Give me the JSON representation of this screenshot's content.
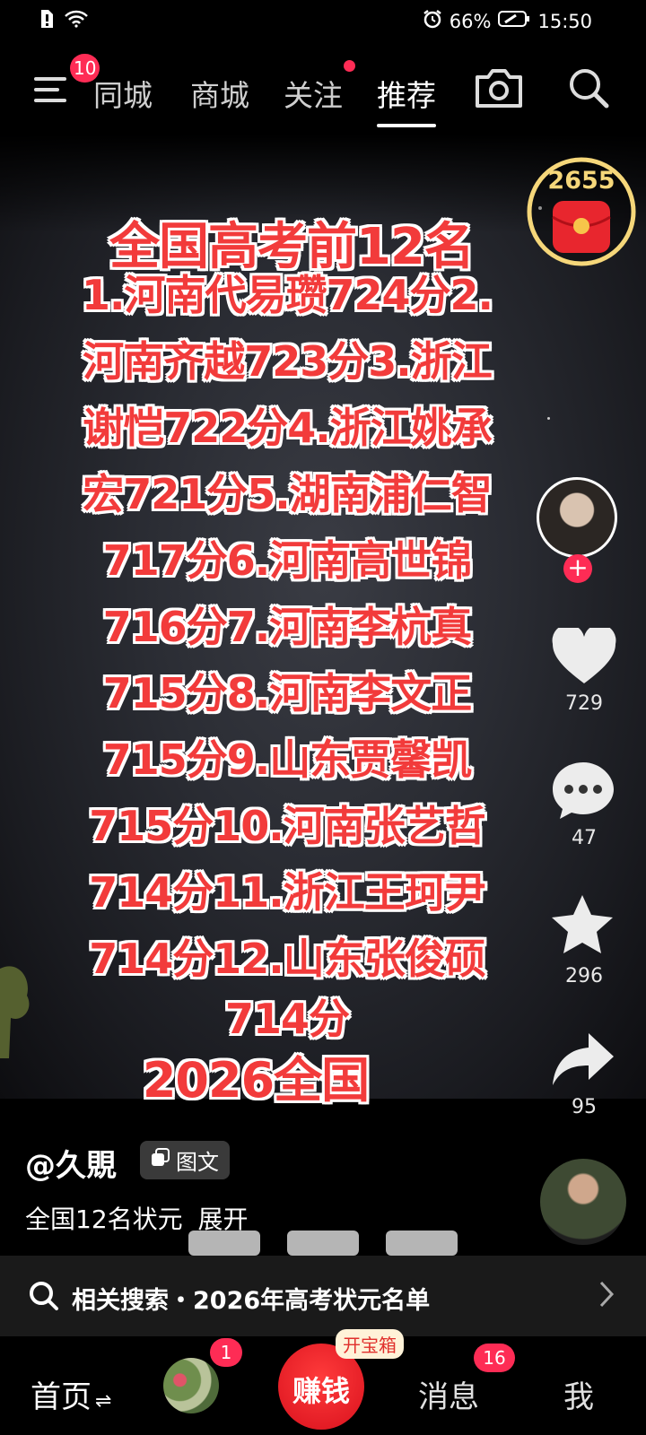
{
  "status_bar": {
    "battery": "66%",
    "time": "15:50"
  },
  "top_nav": {
    "menu_badge": "10",
    "tabs": [
      {
        "label": "同城"
      },
      {
        "label": "商城"
      },
      {
        "label": "关注"
      },
      {
        "label": "推荐"
      }
    ]
  },
  "red_packet": {
    "count": "2655"
  },
  "caption": {
    "lines": [
      "全国高考前12名",
      "1.河南代易瓒724分2.",
      "河南齐越723分3.浙江",
      "谢恺722分4.浙江姚承",
      "宏721分5.湖南浦仁智",
      "717分6.河南高世锦",
      "716分7.河南李杭真",
      "715分8.河南李文正",
      "715分9.山东贾馨凯",
      "715分10.河南张艺哲",
      "714分11.浙江王珂尹",
      "714分12.山东张俊硕",
      "714分",
      "2026全国"
    ]
  },
  "actions": {
    "likes": "729",
    "comments": "47",
    "favorites": "296",
    "shares": "95"
  },
  "post": {
    "author": "@久覞",
    "type_label": "图文",
    "description": "全国12名状元",
    "expand_label": "展开"
  },
  "related_search": {
    "prefix": "相关搜索",
    "query": "2026年高考状元名单"
  },
  "bottom_nav": {
    "home": "首页",
    "earn": "赚钱",
    "earn_tag": "开宝箱",
    "friends_badge": "1",
    "messages": "消息",
    "messages_badge": "16",
    "me": "我"
  },
  "colors": {
    "accent": "#fe2c55",
    "caption_red": "#f23b3b"
  }
}
